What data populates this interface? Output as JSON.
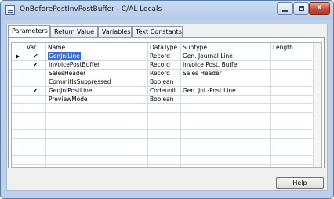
{
  "window": {
    "title": "OnBeforePostInvPostBuffer - C/AL Locals"
  },
  "tabs": [
    {
      "label": "Parameters",
      "active": true
    },
    {
      "label": "Return Value",
      "active": false
    },
    {
      "label": "Variables",
      "active": false
    },
    {
      "label": "Text Constants",
      "active": false
    }
  ],
  "grid": {
    "columns": {
      "var": "Var",
      "name": "Name",
      "datatype": "DataType",
      "subtype": "Subtype",
      "length": "Length"
    },
    "rows": [
      {
        "var": "✔",
        "name": "GenJnlLine",
        "datatype": "Record",
        "subtype": "Gen. Journal Line",
        "length": "",
        "selected": true
      },
      {
        "var": "✔",
        "name": "InvoicePostBuffer",
        "datatype": "Record",
        "subtype": "Invoice Post. Buffer",
        "length": ""
      },
      {
        "var": "",
        "name": "SalesHeader",
        "datatype": "Record",
        "subtype": "Sales Header",
        "length": ""
      },
      {
        "var": "",
        "name": "CommitIsSuppressed",
        "datatype": "Boolean",
        "subtype": "",
        "length": ""
      },
      {
        "var": "✔",
        "name": "GenJnlPostLine",
        "datatype": "Codeunit",
        "subtype": "Gen. Jnl.-Post Line",
        "length": ""
      },
      {
        "var": "",
        "name": "PreviewMode",
        "datatype": "Boolean",
        "subtype": "",
        "length": ""
      }
    ]
  },
  "buttons": {
    "help": "Help"
  },
  "colors": {
    "selection": "#3a6ed1",
    "titlebar": "#c9dcf2"
  }
}
